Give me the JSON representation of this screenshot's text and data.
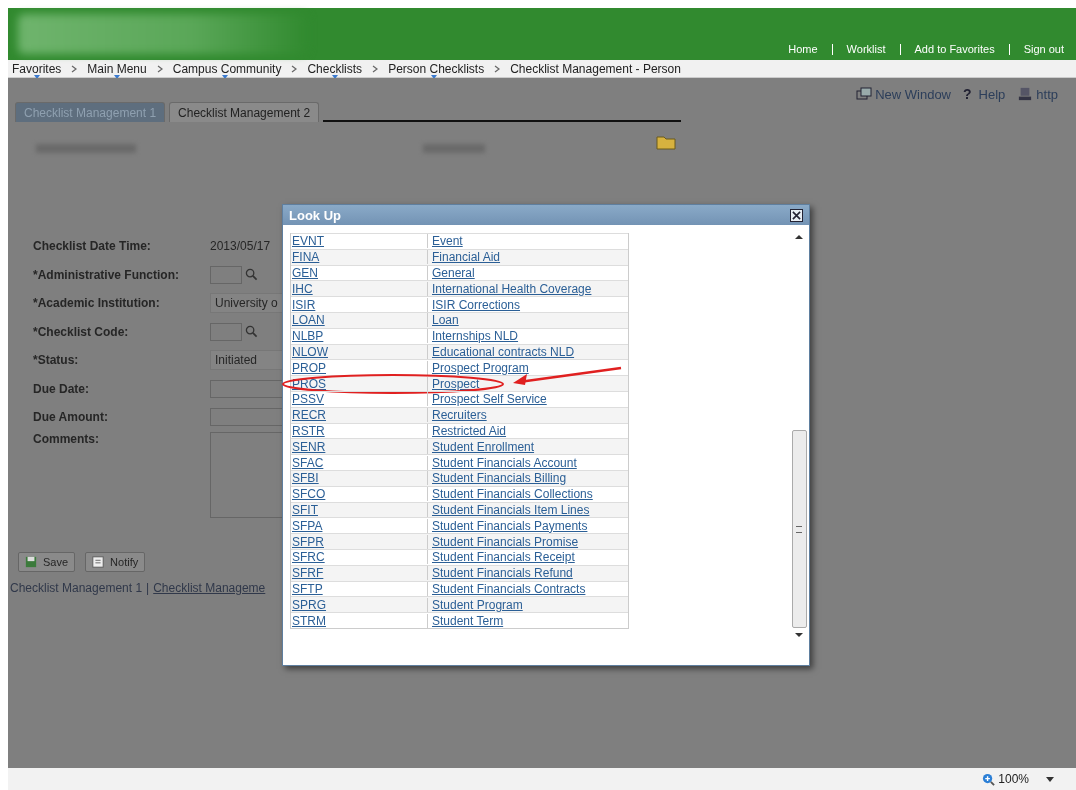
{
  "header": {
    "links": [
      "Home",
      "Worklist",
      "Add to Favorites",
      "Sign out"
    ]
  },
  "breadcrumbs": [
    {
      "label": "Favorites",
      "menu": true
    },
    {
      "label": "Main Menu",
      "menu": true
    },
    {
      "label": "Campus Community",
      "menu": true
    },
    {
      "label": "Checklists",
      "menu": true
    },
    {
      "label": "Person Checklists",
      "menu": true
    },
    {
      "label": "Checklist Management - Person",
      "menu": false
    }
  ],
  "toolbar": [
    "New Window",
    "Help",
    "http"
  ],
  "help_icon": "?",
  "tabs": [
    {
      "label": "Checklist Management 1",
      "selected": true
    },
    {
      "label": "Checklist Management 2",
      "selected": false
    }
  ],
  "form": {
    "fields": [
      {
        "label": "Checklist Date Time:",
        "kind": "text",
        "value": "2013/05/17"
      },
      {
        "label": "*Administrative Function:",
        "kind": "lookup"
      },
      {
        "label": "*Academic Institution:",
        "kind": "select",
        "value": "University o"
      },
      {
        "label": "*Checklist Code:",
        "kind": "lookup"
      },
      {
        "label": "*Status:",
        "kind": "select",
        "value": "Initiated"
      },
      {
        "label": "Due Date:",
        "kind": "input"
      },
      {
        "label": "Due Amount:",
        "kind": "input"
      },
      {
        "label": "Comments:",
        "kind": "textarea"
      }
    ]
  },
  "buttons": [
    "Save",
    "Notify"
  ],
  "footer_links": [
    "Checklist Management 1",
    "Checklist Manageme"
  ],
  "footer_separator": "|",
  "lookup": {
    "title": "Look Up",
    "rows": [
      {
        "code": "EVNT",
        "description": "Event",
        "annotated": false
      },
      {
        "code": "FINA",
        "description": "Financial Aid",
        "annotated": false
      },
      {
        "code": "GEN",
        "description": "General",
        "annotated": false
      },
      {
        "code": "IHC",
        "description": "International Health Coverage",
        "annotated": false
      },
      {
        "code": "ISIR",
        "description": "ISIR Corrections",
        "annotated": false
      },
      {
        "code": "LOAN",
        "description": "Loan",
        "annotated": false
      },
      {
        "code": "NLBP",
        "description": "Internships NLD",
        "annotated": false
      },
      {
        "code": "NLOW",
        "description": "Educational contracts NLD",
        "annotated": false
      },
      {
        "code": "PROP",
        "description": "Prospect Program",
        "annotated": false
      },
      {
        "code": "PROS",
        "description": "Prospect",
        "annotated": true
      },
      {
        "code": "PSSV",
        "description": "Prospect Self Service",
        "annotated": false
      },
      {
        "code": "RECR",
        "description": "Recruiters",
        "annotated": false
      },
      {
        "code": "RSTR",
        "description": "Restricted Aid",
        "annotated": false
      },
      {
        "code": "SENR",
        "description": "Student Enrollment",
        "annotated": false
      },
      {
        "code": "SFAC",
        "description": "Student Financials Account",
        "annotated": false
      },
      {
        "code": "SFBI",
        "description": "Student Financials Billing",
        "annotated": false
      },
      {
        "code": "SFCO",
        "description": "Student Financials Collections",
        "annotated": false
      },
      {
        "code": "SFIT",
        "description": "Student Financials Item Lines",
        "annotated": false
      },
      {
        "code": "SFPA",
        "description": "Student Financials Payments",
        "annotated": false
      },
      {
        "code": "SFPR",
        "description": "Student Financials Promise",
        "annotated": false
      },
      {
        "code": "SFRC",
        "description": "Student Financials Receipt",
        "annotated": false
      },
      {
        "code": "SFRF",
        "description": "Student Financials Refund",
        "annotated": false
      },
      {
        "code": "SFTP",
        "description": "Student Financials Contracts",
        "annotated": false
      },
      {
        "code": "SPRG",
        "description": "Student Program",
        "annotated": false
      },
      {
        "code": "STRM",
        "description": "Student Term",
        "annotated": false
      }
    ]
  },
  "status_bar": {
    "zoom": "100%"
  }
}
